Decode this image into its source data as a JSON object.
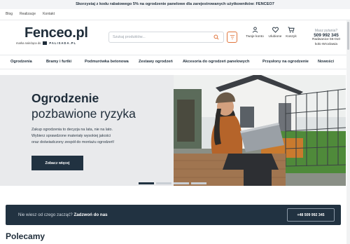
{
  "promo": {
    "text": "Skorzystaj z kodu rabatowego 5% na ogrodzenie panelowe dla zarejestrowanych użytkowników: FENCEO7"
  },
  "toplinks": [
    "Blog",
    "Realizacje",
    "Kontakt"
  ],
  "logo": {
    "name": "Fenceo.pl",
    "tagline": "marka należąca do",
    "brand": "PALISADA.PL"
  },
  "search": {
    "placeholder": "Szukaj produktów..."
  },
  "header_icons": {
    "account": "Twoje konto",
    "wishlist": "Ulubione",
    "cart": "Koszyk"
  },
  "contact": {
    "question": "Masz pytania?",
    "phone": "509 992 345",
    "address1": "Radwanice 55-010",
    "address2": "koło Wrocławia"
  },
  "nav": [
    "Ogrodzenia",
    "Bramy i furtki",
    "Podmurówka betonowa",
    "Zestawy ogrodzeń",
    "Akcesoria do ogrodzeń panelowych",
    "Przęsłony na ogrodzenie",
    "Nowości"
  ],
  "hero": {
    "title": "Ogrodzenie",
    "subtitle": "pozbawione ryzyka",
    "desc1": "Zakup ogrodzenia to decyzja na lata, nie na lato.",
    "desc2": "Wybierz sprawdzone materiały wysokiej jakości",
    "desc3": "oraz doświadczony zespół do montażu ogrodzeń!",
    "button": "Zobacz więcej"
  },
  "cta": {
    "question": "Nie wiesz od czego zacząć?",
    "action": "Zadzwoń do nas",
    "button": "+48 509 992 345"
  },
  "section": {
    "title": "Polecamy"
  },
  "colors": {
    "navy": "#213241",
    "accent": "#e0753c",
    "light_bg": "#e9eaec"
  }
}
